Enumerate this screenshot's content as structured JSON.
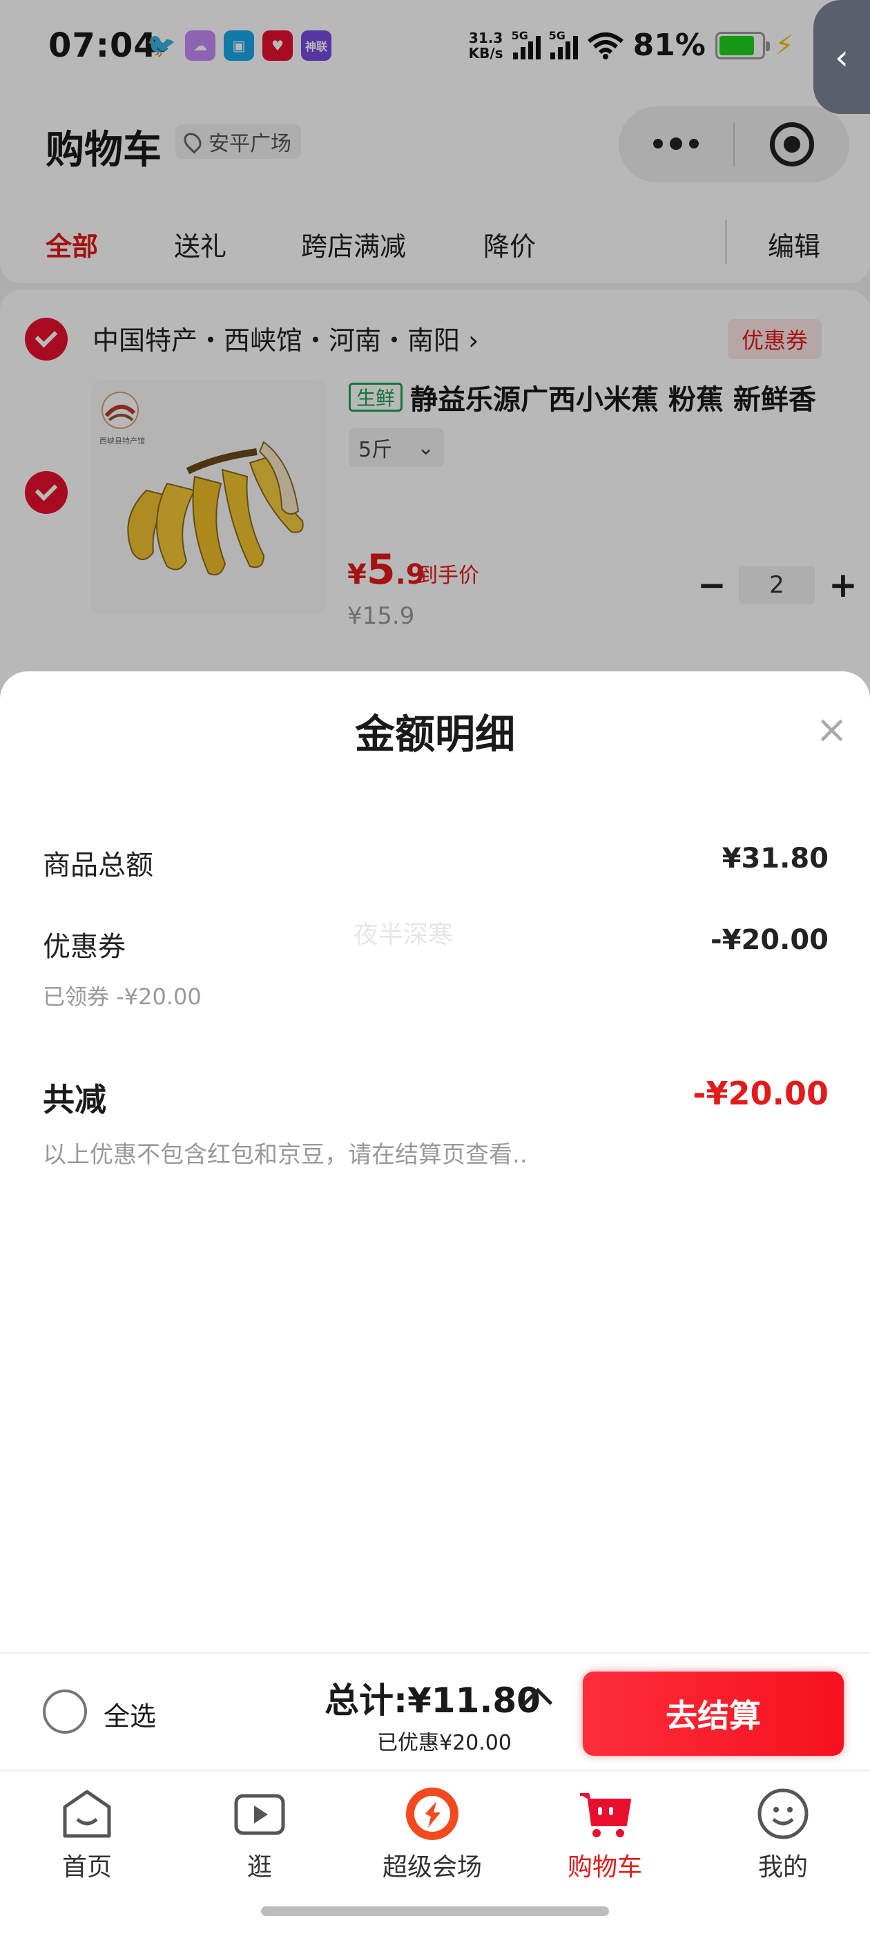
{
  "status_bar": {
    "time": "07:04",
    "net_speed_top": "31.3",
    "net_speed_bottom": "KB/s",
    "signal1": "5G",
    "signal2": "5G",
    "battery": "81%",
    "apps": [
      {
        "icon": "bird-icon",
        "color": "#111111",
        "label": ""
      },
      {
        "icon": "weather-icon",
        "color": "#c58af9",
        "label": ""
      },
      {
        "icon": "sim-card-icon",
        "color": "#1aa7e8",
        "label": ""
      },
      {
        "icon": "heart-app-icon",
        "color": "#e8102e",
        "label": ""
      },
      {
        "icon": "shenlian-app-icon",
        "color": "#7b4ce0",
        "label": "神联"
      }
    ]
  },
  "header": {
    "title": "购物车",
    "location": "安平广场"
  },
  "tabs": [
    {
      "label": "全部",
      "active": true
    },
    {
      "label": "送礼",
      "active": false
    },
    {
      "label": "跨店满减",
      "active": false
    },
    {
      "label": "降价",
      "active": false
    }
  ],
  "edit_label": "编辑",
  "store": {
    "name": "中国特产・西峡馆・河南・南阳",
    "chevron": "›",
    "coupon_tag": "优惠券"
  },
  "product": {
    "tag": "生鲜",
    "title": "静益乐源广西小米蕉 粉蕉 新鲜香",
    "spec": "5斤",
    "price_currency": "¥",
    "price_int": "5",
    "price_dec": ".9",
    "price_label": "到手价",
    "original_price": "¥15.9",
    "quantity": "2",
    "minus": "−",
    "plus": "+",
    "logo_text": "西峡县特产馆"
  },
  "sheet": {
    "title": "金额明细",
    "close": "×",
    "goods_total_label": "商品总额",
    "goods_total_value": "¥31.80",
    "coupon_label": "优惠券",
    "coupon_value": "-¥20.00",
    "coupon_sub": "已领券 -¥20.00",
    "watermark": "夜半深寒",
    "total_discount_label": "共减",
    "total_discount_value": "-¥20.00",
    "note": "以上优惠不包含红包和京豆，请在结算页查看.."
  },
  "checkout": {
    "select_all": "全选",
    "total": "总计:¥11.80",
    "saved": "已优惠¥20.00",
    "pay_button": "去结算"
  },
  "nav": [
    {
      "label": "首页",
      "icon": "home-icon",
      "active": false
    },
    {
      "label": "逛",
      "icon": "video-icon",
      "active": false
    },
    {
      "label": "超级会场",
      "icon": "super-venue-icon",
      "active": false
    },
    {
      "label": "购物车",
      "icon": "cart-icon",
      "active": true
    },
    {
      "label": "我的",
      "icon": "profile-icon",
      "active": false
    }
  ],
  "colors": {
    "accent": "#e41a1a",
    "pay_button": "#fe2e3b",
    "fresh_tag": "#1aa051"
  }
}
